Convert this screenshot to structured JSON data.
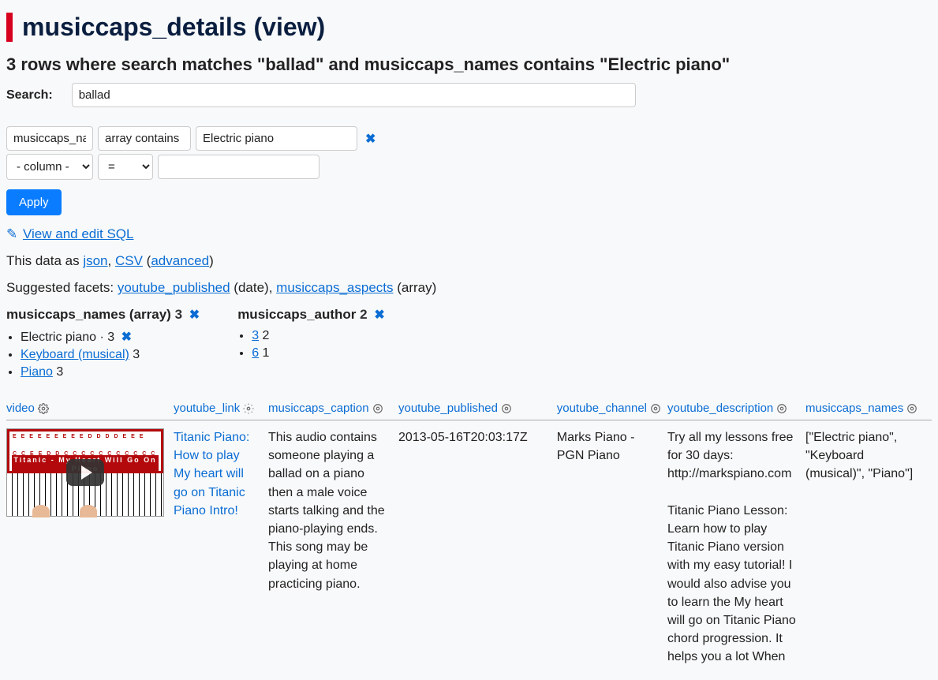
{
  "title": "musiccaps_details",
  "title_suffix": " (view)",
  "filter_summary": "3 rows where search matches \"ballad\" and musiccaps_names contains \"Electric piano\"",
  "search_label": "Search:",
  "search_value": "ballad",
  "filters": {
    "row1": {
      "col": "musiccaps_names",
      "op": "array contains",
      "val": "Electric piano"
    },
    "row2": {
      "col": "- column -",
      "op": "=",
      "val": ""
    }
  },
  "apply_label": "Apply",
  "sql_link": "View and edit SQL",
  "export_prefix": "This data as ",
  "export_json": "json",
  "export_csv": "CSV",
  "export_advanced": "advanced",
  "suggested_prefix": "Suggested facets: ",
  "suggested_1": "youtube_published",
  "suggested_1_suffix": " (date), ",
  "suggested_2": "musiccaps_aspects",
  "suggested_2_suffix": " (array)",
  "facets": {
    "names": {
      "title": "musiccaps_names (array)",
      "title_count": "3",
      "items": [
        {
          "label": "Electric piano",
          "count": "3",
          "selected": true
        },
        {
          "label": "Keyboard (musical)",
          "count": "3",
          "selected": false
        },
        {
          "label": "Piano",
          "count": "3",
          "selected": false
        }
      ]
    },
    "author": {
      "title": "musiccaps_author",
      "title_count": "2",
      "items": [
        {
          "label": "3",
          "count": "2"
        },
        {
          "label": "6",
          "count": "1"
        }
      ]
    }
  },
  "columns": {
    "video": "video",
    "youtube_link": "youtube_link",
    "musiccaps_caption": "musiccaps_caption",
    "youtube_published": "youtube_published",
    "youtube_channel": "youtube_channel",
    "youtube_description": "youtube_description",
    "musiccaps_names": "musiccaps_names"
  },
  "video_thumb": {
    "notes_row1": "E  E  E  E  E  E  E  E  E    D  D  D  D   E  E  E",
    "notes_row2": "C  C  E  E   D  D   C  C  C  C  C  C  C  C   C  C  C  C",
    "overlay_title": "Titanic - My Heart Will Go On Piano"
  },
  "row": {
    "youtube_link": "Titanic Piano: How to play My heart will go on Titanic Piano Intro!",
    "caption": "This audio contains someone playing a ballad on a piano then a male voice starts talking and the piano-playing ends. This song may be playing at home practicing piano.",
    "published": "2013-05-16T20:03:17Z",
    "channel": "Marks Piano - PGN Piano",
    "description": "Try all my lessons free for 30 days: http://markspiano.com\n\nTitanic Piano Lesson: Learn how to play Titanic Piano version with my easy tutorial! I would also advise you to learn the My heart will go on Titanic Piano chord progression. It helps you a lot When",
    "names": "[\"Electric piano\", \"Keyboard (musical)\", \"Piano\"]"
  }
}
